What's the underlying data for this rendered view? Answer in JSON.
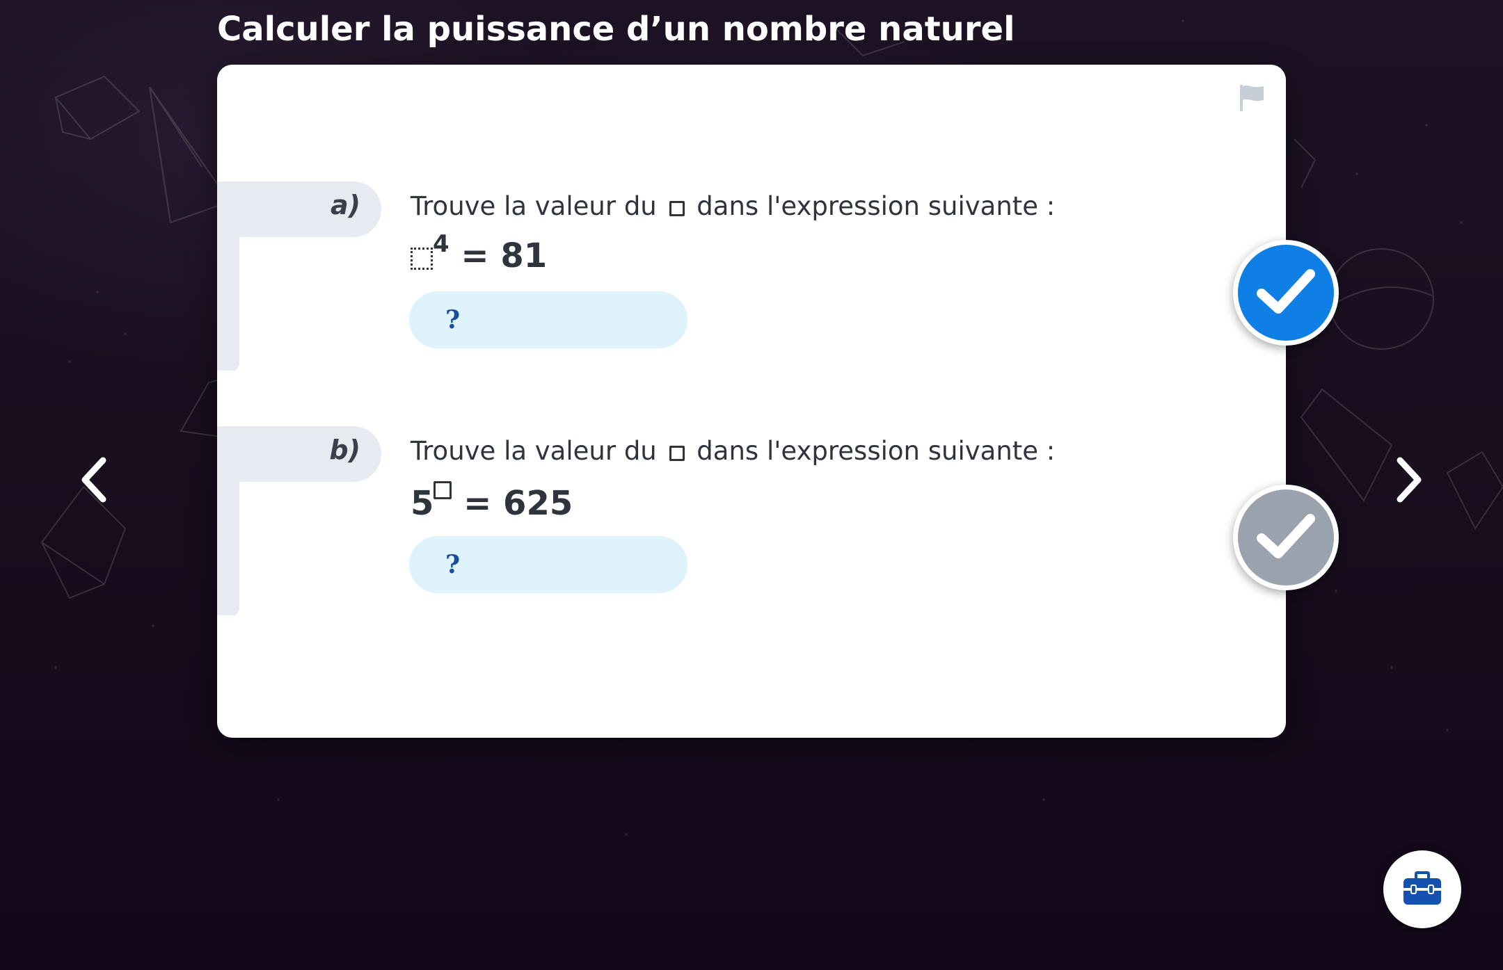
{
  "header": {
    "title": "Calculer la puissance d’un nombre naturel"
  },
  "questions": [
    {
      "letter": "a)",
      "prompt_before": "Trouve la valeur du",
      "prompt_after": "dans l'expression suivante :",
      "expression_exponent": "4",
      "expression_rhs": "= 81",
      "answer_placeholder": "?",
      "answer_value": "",
      "check_state": "active"
    },
    {
      "letter": "b)",
      "prompt_before": "Trouve la valeur du",
      "prompt_after": "dans l'expression suivante :",
      "expression_base": "5",
      "expression_rhs": "= 625",
      "answer_placeholder": "?",
      "answer_value": "",
      "check_state": "inactive"
    }
  ],
  "icons": {
    "flag": "flag-icon",
    "check": "checkmark-icon",
    "prev": "chevron-left-icon",
    "next": "chevron-right-icon",
    "toolbox": "toolbox-icon"
  },
  "colors": {
    "check_active": "#0f7fe6",
    "check_inactive": "#9aa2ae",
    "answer_field_bg": "#dff3fc",
    "answer_text": "#1a4d9a",
    "toolbox_icon": "#1552b0",
    "label_pill_bg": "#e8eaf2"
  }
}
